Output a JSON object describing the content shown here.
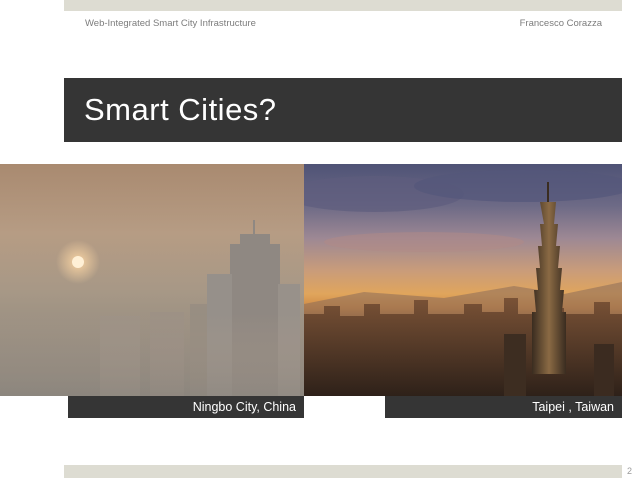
{
  "header": {
    "left_text": "Web-Integrated Smart City Infrastructure",
    "right_text": "Francesco Corazza"
  },
  "slide": {
    "title": "Smart Cities?",
    "page_number": "2"
  },
  "photos": [
    {
      "caption": "Ningbo City, China",
      "icon": "hazy-city-skyline-photo"
    },
    {
      "caption": "Taipei , Taiwan",
      "icon": "sunset-taipei-101-skyline-photo"
    }
  ],
  "colors": {
    "band": "#353535",
    "accent_bar": "#dddcd2",
    "header_text": "#7c7c7c"
  }
}
